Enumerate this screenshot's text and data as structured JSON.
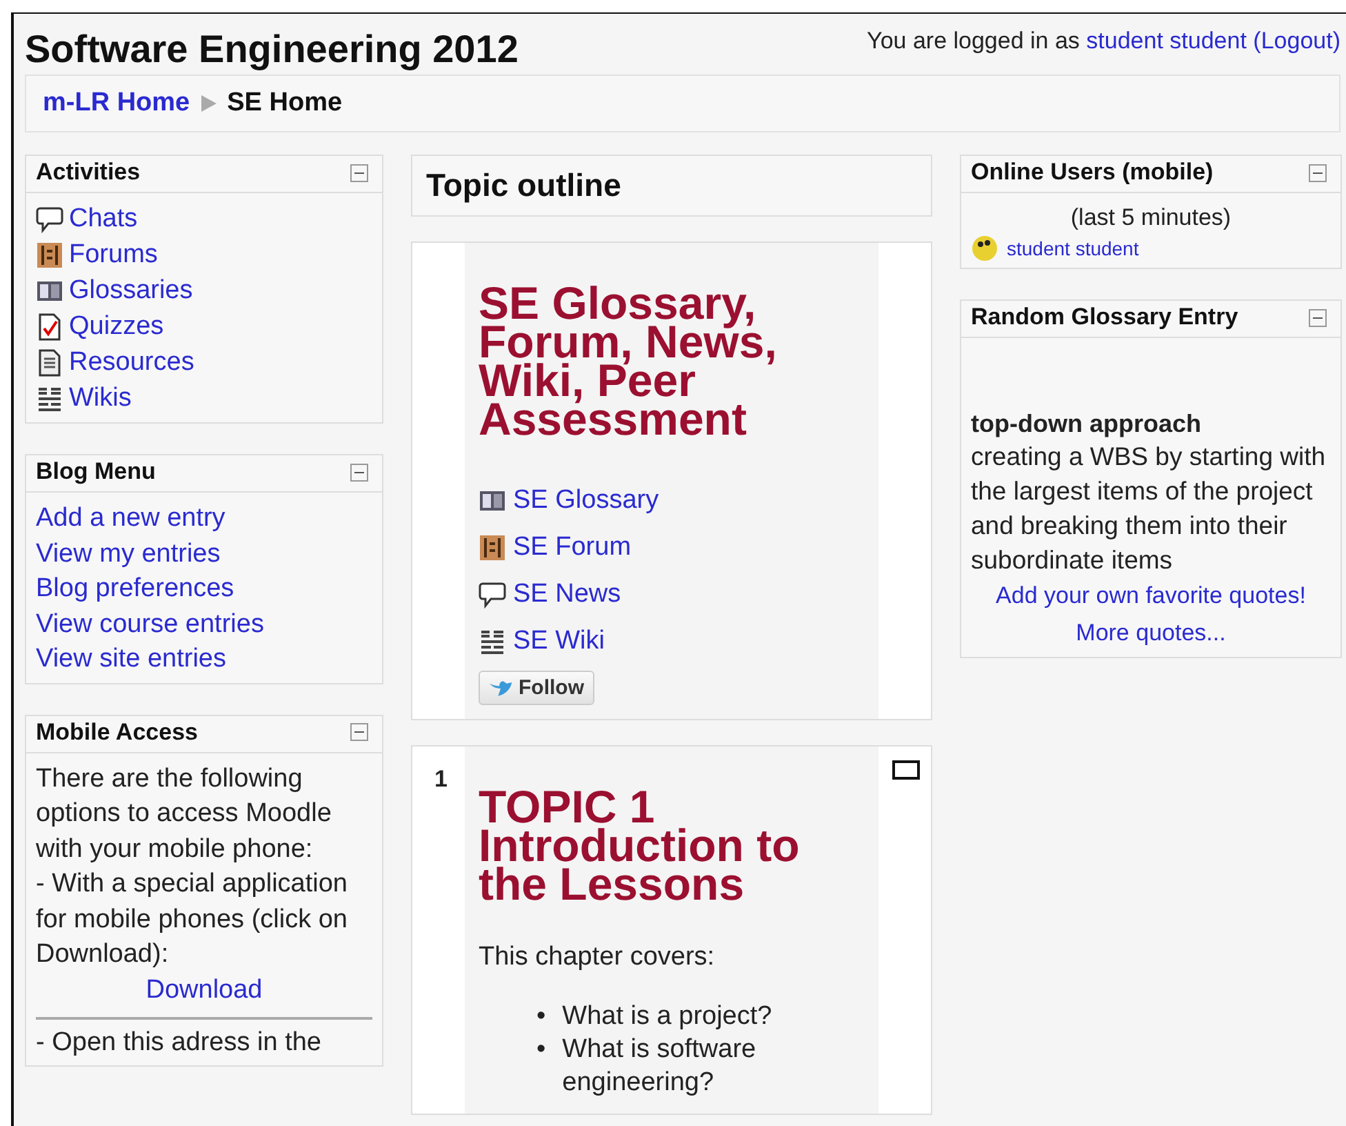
{
  "header": {
    "title": "Software Engineering 2012",
    "login_prefix": "You are logged in as",
    "user_link": "student student",
    "logout_link": "(Logout)"
  },
  "breadcrumb": [
    {
      "label": "m-LR Home",
      "kind": "link"
    },
    {
      "label": "SE Home",
      "kind": "current"
    }
  ],
  "left_blocks": [
    {
      "title": "Activities",
      "kind": "icon-links",
      "items": [
        {
          "label": "Chats",
          "kind": "chat"
        },
        {
          "label": "Forums",
          "kind": "forum"
        },
        {
          "label": "Glossaries",
          "kind": "glossary"
        },
        {
          "label": "Quizzes",
          "kind": "quiz"
        },
        {
          "label": "Resources",
          "kind": "resource"
        },
        {
          "label": "Wikis",
          "kind": "wiki"
        }
      ]
    },
    {
      "title": "Blog Menu",
      "kind": "links",
      "items": [
        {
          "label": "Add a new entry"
        },
        {
          "label": "View my entries"
        },
        {
          "label": "Blog preferences"
        },
        {
          "label": "View course entries"
        },
        {
          "label": "View site entries"
        }
      ]
    },
    {
      "title": "Mobile Access",
      "kind": "text",
      "paragraphs": [
        "There are the following options to access Moodle with your mobile phone:",
        "- With a special application for mobile phones (click on Download):"
      ],
      "link": "Download",
      "after": "- Open this adress in the"
    }
  ],
  "center": {
    "title": "Topic outline",
    "sections": [
      {
        "heading": "SE Glossary, Forum, News, Wiki, Peer Assessment",
        "items": [
          {
            "label": "SE Glossary",
            "kind": "glossary"
          },
          {
            "label": "SE Forum",
            "kind": "forum"
          },
          {
            "label": "SE News",
            "kind": "chat"
          },
          {
            "label": "SE Wiki",
            "kind": "wiki"
          }
        ],
        "follow_button": "Follow"
      },
      {
        "number": "1",
        "heading": "TOPIC 1 Introduction to the Lessons",
        "intro": "This chapter covers:",
        "bullets": [
          {
            "marker": "•",
            "text": "What is a project?"
          },
          {
            "marker": "•",
            "text": "What is software engineering?"
          }
        ]
      }
    ]
  },
  "right_blocks": [
    {
      "title": "Online Users (mobile)",
      "kind": "users",
      "subtitle": "(last 5 minutes)",
      "users": [
        "student student"
      ]
    },
    {
      "title": "Random Glossary Entry",
      "kind": "glossary",
      "term": "top-down approach",
      "definition": "creating a WBS by starting with the largest items of the project and breaking them into their subordinate items",
      "links": [
        "Add your own favorite quotes!",
        "More quotes..."
      ]
    }
  ]
}
